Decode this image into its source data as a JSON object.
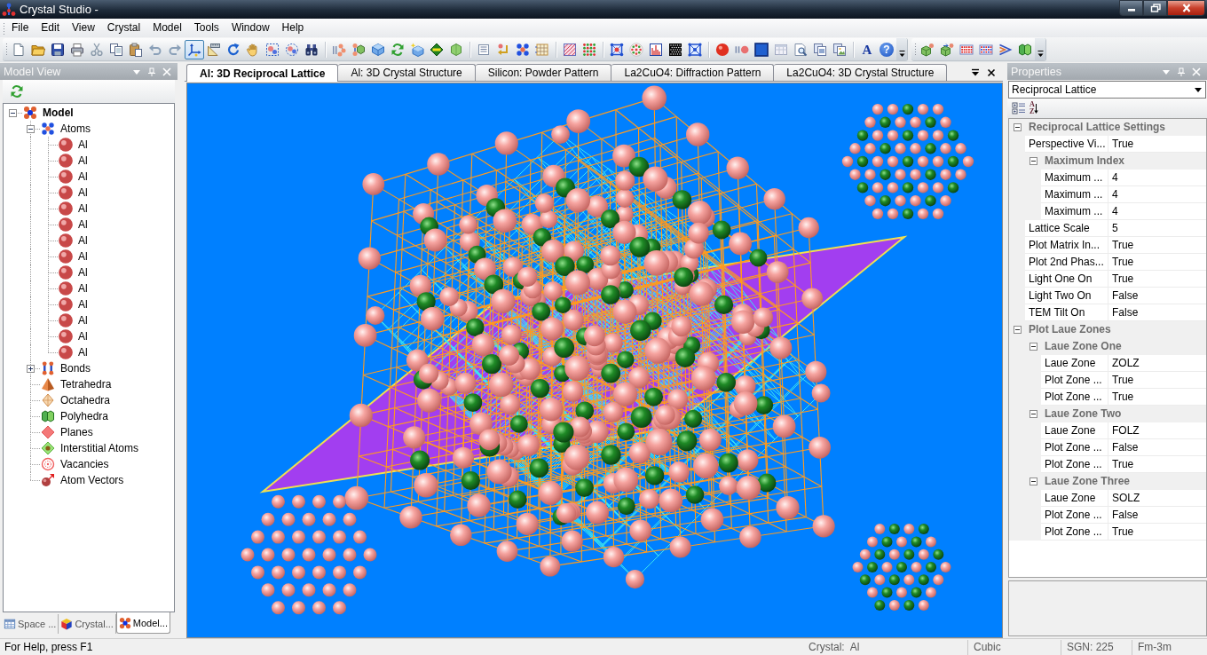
{
  "window": {
    "title": "Crystal Studio -"
  },
  "menu": [
    "File",
    "Edit",
    "View",
    "Crystal",
    "Model",
    "Tools",
    "Window",
    "Help"
  ],
  "toolbars": [
    {
      "groups": [
        [
          {
            "selected": false
          },
          {
            "selected": false
          },
          {
            "selected": false
          },
          {
            "selected": false
          },
          {
            "selected": false
          },
          {
            "selected": false
          },
          {
            "selected": false
          },
          {
            "selected": false
          },
          {
            "selected": false
          },
          {
            "selected": true
          },
          {
            "selected": false
          },
          {
            "selected": false
          },
          {
            "selected": false
          },
          {
            "selected": false
          },
          {
            "selected": false
          },
          {
            "selected": false
          }
        ],
        [
          {
            "selected": false
          },
          {
            "selected": false
          },
          {
            "selected": false
          },
          {
            "selected": false
          },
          {
            "selected": false
          },
          {
            "selected": false
          },
          {
            "selected": false
          }
        ],
        [
          {
            "selected": false
          },
          {
            "selected": false
          },
          {
            "selected": false
          },
          {
            "selected": false
          }
        ],
        [
          {
            "selected": false
          },
          {
            "selected": false
          }
        ],
        [
          {
            "selected": false
          },
          {
            "selected": false
          },
          {
            "selected": false
          },
          {
            "selected": false
          },
          {
            "selected": false
          }
        ],
        [
          {
            "selected": false
          },
          {
            "selected": false
          },
          {
            "selected": false
          },
          {
            "selected": false
          },
          {
            "selected": false
          },
          {
            "selected": false
          },
          {
            "selected": false
          }
        ],
        [
          {
            "selected": false,
            "label": "A"
          },
          {
            "selected": false,
            "label": "?"
          }
        ]
      ]
    },
    {
      "groups": [
        [
          {
            "selected": false
          },
          {
            "selected": false
          },
          {
            "selected": false
          },
          {
            "selected": false
          },
          {
            "selected": false
          },
          {
            "selected": false
          }
        ]
      ]
    }
  ],
  "left_panel": {
    "title": "Model View",
    "tree": [
      {
        "label": "Model",
        "expanded": true,
        "children": [
          {
            "label": "Atoms",
            "expanded": true,
            "children": [
              {
                "label": "Al"
              },
              {
                "label": "Al"
              },
              {
                "label": "Al"
              },
              {
                "label": "Al"
              },
              {
                "label": "Al"
              },
              {
                "label": "Al"
              },
              {
                "label": "Al"
              },
              {
                "label": "Al"
              },
              {
                "label": "Al"
              },
              {
                "label": "Al"
              },
              {
                "label": "Al"
              },
              {
                "label": "Al"
              },
              {
                "label": "Al"
              },
              {
                "label": "Al"
              }
            ]
          },
          {
            "label": "Bonds",
            "expanded": false
          },
          {
            "label": "Tetrahedra"
          },
          {
            "label": "Octahedra"
          },
          {
            "label": "Polyhedra"
          },
          {
            "label": "Planes"
          },
          {
            "label": "Interstitial Atoms"
          },
          {
            "label": "Vacancies"
          },
          {
            "label": "Atom Vectors"
          }
        ]
      }
    ],
    "tabs": [
      {
        "label": "Space ...",
        "selected": false
      },
      {
        "label": "Crystal...",
        "selected": false
      },
      {
        "label": "Model...",
        "selected": true
      }
    ]
  },
  "documents": {
    "tabs": [
      {
        "label": "Al: 3D Reciprocal Lattice",
        "selected": true
      },
      {
        "label": "Al: 3D Crystal Structure",
        "selected": false
      },
      {
        "label": "Silicon: Powder Pattern",
        "selected": false
      },
      {
        "label": "La2CuO4: Diffraction Pattern",
        "selected": false
      },
      {
        "label": "La2CuO4: 3D Crystal Structure",
        "selected": false
      }
    ]
  },
  "properties": {
    "title": "Properties",
    "selector": "Reciprocal Lattice",
    "sort_label": "AZ",
    "groups": [
      {
        "kind": "group",
        "title": "Reciprocal Lattice Settings",
        "expanded": true,
        "children": [
          {
            "kind": "property",
            "name": "Perspective Vi...",
            "value": "True"
          },
          {
            "kind": "group",
            "title": "Maximum Index",
            "expanded": true,
            "children": [
              {
                "kind": "property",
                "name": "Maximum ...",
                "value": "4"
              },
              {
                "kind": "property",
                "name": "Maximum ...",
                "value": "4"
              },
              {
                "kind": "property",
                "name": "Maximum ...",
                "value": "4"
              }
            ]
          },
          {
            "kind": "property",
            "name": "Lattice Scale",
            "value": "5"
          },
          {
            "kind": "property",
            "name": "Plot Matrix In...",
            "value": "True"
          },
          {
            "kind": "property",
            "name": "Plot 2nd Phas...",
            "value": "True"
          },
          {
            "kind": "property",
            "name": "Light One On",
            "value": "True"
          },
          {
            "kind": "property",
            "name": "Light Two On",
            "value": "False"
          },
          {
            "kind": "property",
            "name": "TEM Tilt On",
            "value": "False"
          }
        ]
      },
      {
        "kind": "group",
        "title": "Plot Laue Zones",
        "expanded": true,
        "children": [
          {
            "kind": "group",
            "title": "Laue Zone One",
            "expanded": true,
            "children": [
              {
                "kind": "property",
                "name": "Laue Zone",
                "value": "ZOLZ"
              },
              {
                "kind": "property",
                "name": "Plot Zone ...",
                "value": "True"
              },
              {
                "kind": "property",
                "name": "Plot Zone ...",
                "value": "True"
              }
            ]
          },
          {
            "kind": "group",
            "title": "Laue Zone Two",
            "expanded": true,
            "children": [
              {
                "kind": "property",
                "name": "Laue Zone",
                "value": "FOLZ"
              },
              {
                "kind": "property",
                "name": "Plot Zone ...",
                "value": "False"
              },
              {
                "kind": "property",
                "name": "Plot Zone ...",
                "value": "True"
              }
            ]
          },
          {
            "kind": "group",
            "title": "Laue Zone Three",
            "expanded": true,
            "children": [
              {
                "kind": "property",
                "name": "Laue Zone",
                "value": "SOLZ"
              },
              {
                "kind": "property",
                "name": "Plot Zone ...",
                "value": "False"
              },
              {
                "kind": "property",
                "name": "Plot Zone ...",
                "value": "True"
              }
            ]
          }
        ]
      }
    ]
  },
  "status_bar": {
    "help": "For Help, press F1",
    "panes": [
      "Crystal:  Al",
      "Cubic",
      "SGN: 225",
      "Fm-3m"
    ]
  }
}
